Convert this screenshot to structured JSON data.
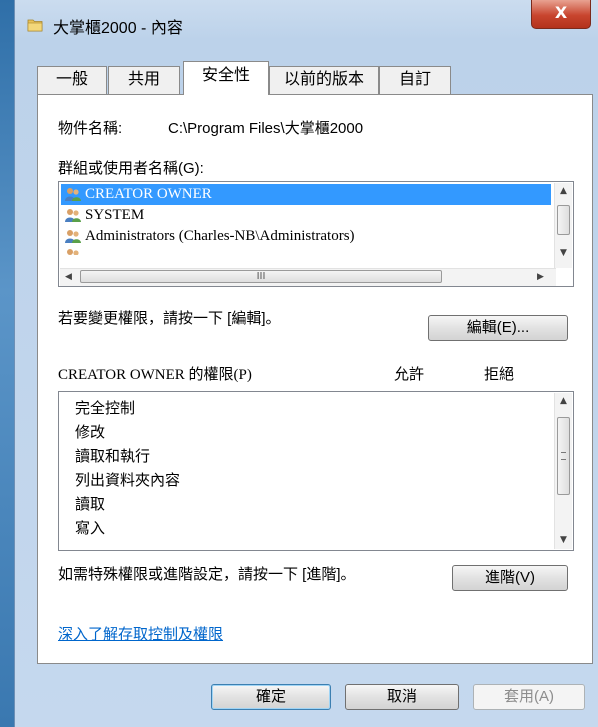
{
  "window": {
    "title": "大掌櫃2000 - 內容",
    "close_label": "X"
  },
  "tabs": [
    {
      "label": "一般"
    },
    {
      "label": "共用"
    },
    {
      "label": "安全性"
    },
    {
      "label": "以前的版本"
    },
    {
      "label": "自訂"
    }
  ],
  "active_tab": "安全性",
  "security": {
    "object_name_label": "物件名稱:",
    "object_name_value": "C:\\Program Files\\大掌櫃2000",
    "groups_label": "群組或使用者名稱(G):",
    "groups": [
      {
        "name": "CREATOR OWNER",
        "selected": true
      },
      {
        "name": "SYSTEM",
        "selected": false
      },
      {
        "name": "Administrators (Charles-NB\\Administrators)",
        "selected": false
      },
      {
        "name": "",
        "selected": false
      }
    ],
    "hscroll_grip": "III",
    "change_hint": "若要變更權限，請按一下 [編輯]。",
    "edit_button": "編輯(E)...",
    "permissions_label": "CREATOR OWNER 的權限(P)",
    "allow_header": "允許",
    "deny_header": "拒絕",
    "permissions": [
      "完全控制",
      "修改",
      "讀取和執行",
      "列出資料夾內容",
      "讀取",
      "寫入"
    ],
    "advanced_hint": "如需特殊權限或進階設定，請按一下 [進階]。",
    "advanced_button": "進階(V)",
    "help_link": "深入了解存取控制及權限"
  },
  "footer": {
    "ok_button": "確定",
    "cancel_button": "取消",
    "apply_button": "套用(A)"
  },
  "colors": {
    "selection": "#3399ff",
    "link": "#0066cc",
    "close": "#c8452e"
  },
  "icons": [
    "folder-icon",
    "users-icon",
    "scroll-up-icon",
    "scroll-down-icon",
    "scroll-left-icon",
    "scroll-right-icon",
    "close-icon"
  ]
}
